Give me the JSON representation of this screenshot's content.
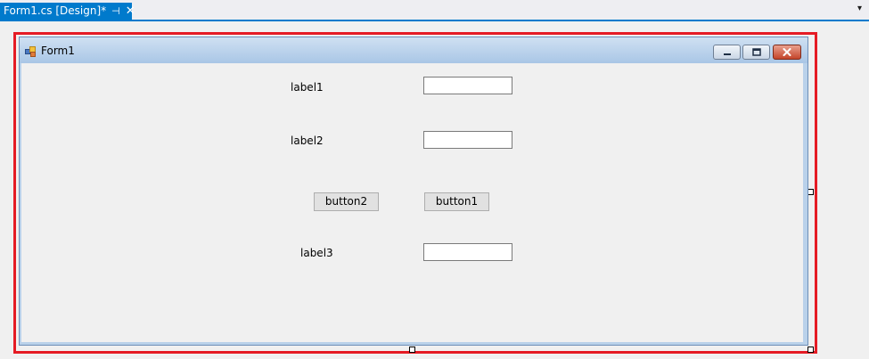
{
  "tab": {
    "title": "Form1.cs [Design]*",
    "pin_glyph": "⊣",
    "close_glyph": "✕",
    "overflow_glyph": "▾"
  },
  "form": {
    "title": "Form1"
  },
  "controls": {
    "label1": "label1",
    "label2": "label2",
    "label3": "label3",
    "button1": "button1",
    "button2": "button2",
    "textbox1": "",
    "textbox2": "",
    "textbox3": ""
  },
  "colors": {
    "tab_accent": "#007acc",
    "selection_border": "#e51b24",
    "client_bg": "#f0f0f0"
  },
  "icons": {
    "form_icon": "form-app-icon",
    "minimize": "minimize-icon",
    "maximize": "maximize-icon",
    "close": "close-icon"
  }
}
